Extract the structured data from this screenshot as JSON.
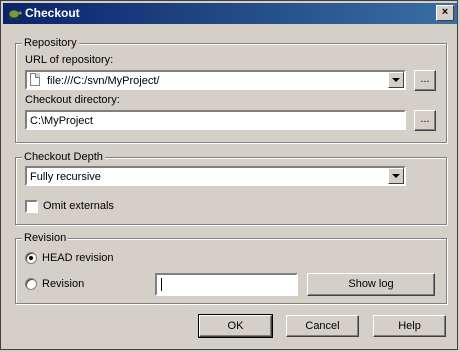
{
  "window": {
    "title": "Checkout",
    "close_glyph": "×",
    "app_icon": "tortoise-icon"
  },
  "repository": {
    "legend": "Repository",
    "url_label": "URL of repository:",
    "url_value": "file:///C:/svn/MyProject/",
    "url_browse": "...",
    "dir_label": "Checkout directory:",
    "dir_value": "C:\\MyProject",
    "dir_browse": "..."
  },
  "depth": {
    "legend": "Checkout Depth",
    "selected": "Fully recursive",
    "omit_externals_label": "Omit externals",
    "omit_externals_checked": false
  },
  "revision": {
    "legend": "Revision",
    "head_label": "HEAD revision",
    "head_selected": true,
    "revision_label": "Revision",
    "revision_value": "",
    "show_log": "Show log"
  },
  "buttons": {
    "ok": "OK",
    "cancel": "Cancel",
    "help": "Help"
  }
}
